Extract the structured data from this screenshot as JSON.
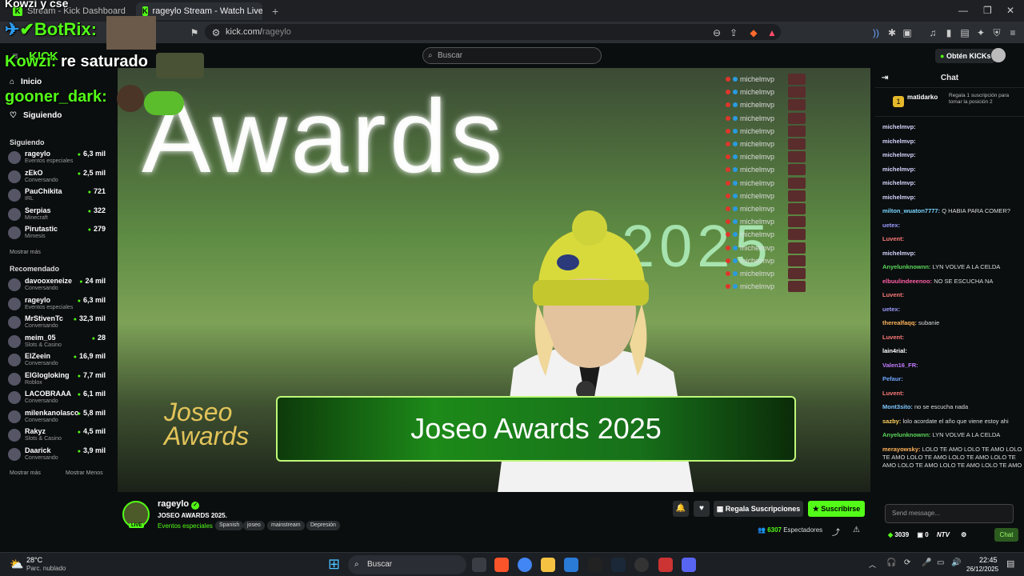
{
  "browser": {
    "tabs": [
      {
        "label": "Stream - Kick Dashboard"
      },
      {
        "label": "rageylo Stream - Watch Live o"
      }
    ],
    "new_tab_symbol": "+",
    "url_host": "kick.com/",
    "url_path": "rageylo"
  },
  "overlay": {
    "line1": "Kowzi y cse",
    "bot": "BotRix:",
    "kowzi_user": "Kowzi:",
    "kowzi_msg": "re saturado",
    "gooner": "gooner_dark:"
  },
  "kick": {
    "logo": "KICK",
    "search_placeholder": "Buscar",
    "kicks_button": "Obtén KICKs",
    "nav": [
      {
        "label": "Inicio"
      },
      {
        "label": "Siguiendo"
      }
    ],
    "following_title": "Siguiendo",
    "following": [
      {
        "name": "rageylo",
        "category": "Eventos especiales",
        "viewers": "6,3 mil"
      },
      {
        "name": "zEkO",
        "category": "Conversando",
        "viewers": "2,5 mil"
      },
      {
        "name": "PauChikita",
        "category": "IRL",
        "viewers": "721"
      },
      {
        "name": "Serpias",
        "category": "Minecraft",
        "viewers": "322"
      },
      {
        "name": "Pirutastic",
        "category": "Mimesis",
        "viewers": "279"
      }
    ],
    "show_more": "Mostrar más",
    "recommended_title": "Recomendado",
    "recommended": [
      {
        "name": "davooxeneize",
        "category": "Conversando",
        "viewers": "24 mil"
      },
      {
        "name": "rageylo",
        "category": "Eventos especiales",
        "viewers": "6,3 mil"
      },
      {
        "name": "MrStivenTc",
        "category": "Conversando",
        "viewers": "32,3 mil"
      },
      {
        "name": "meim_05",
        "category": "Slots & Casino",
        "viewers": "28"
      },
      {
        "name": "ElZeein",
        "category": "Conversando",
        "viewers": "16,9 mil"
      },
      {
        "name": "ElGlogloking",
        "category": "Roblox",
        "viewers": "7,7 mil"
      },
      {
        "name": "LACOBRAAA",
        "category": "Conversando",
        "viewers": "6,1 mil"
      },
      {
        "name": "milenkanolasco",
        "category": "Conversando",
        "viewers": "5,8 mil"
      },
      {
        "name": "Rakyz",
        "category": "Slots & Casino",
        "viewers": "4,5 mil"
      },
      {
        "name": "Daarick",
        "category": "Conversando",
        "viewers": "3,9 mil"
      }
    ],
    "show_more_2": "Mostrar más",
    "show_less": "Mostrar Menos"
  },
  "video": {
    "big_text": "Awards",
    "year": "2025",
    "logo_line1": "Joseo",
    "logo_line2": "Awards",
    "banner": "Joseo Awards 2025",
    "overlay_chat_user": "michelmvp"
  },
  "stream": {
    "name": "rageylo",
    "title": "JOSEO AWARDS 2025.",
    "category": "Eventos especiales",
    "tags": [
      "Spanish",
      "joseo",
      "mainstream",
      "Depresión"
    ],
    "live": "LIVE",
    "gift_button": "Regala Suscripciones",
    "subscribe_button": "Suscribirse",
    "viewers_count": "6307",
    "viewers_label": "Espectadores"
  },
  "chat": {
    "title": "Chat",
    "pinned_user": "matidarko",
    "pinned_rank": "1",
    "pinned_text": "Regala 1 suscripción para tomar la posición 2",
    "messages": [
      {
        "user": "michelmvp:",
        "text": "",
        "color": "#d6d6ff"
      },
      {
        "user": "michelmvp:",
        "text": "",
        "color": "#d6d6ff"
      },
      {
        "user": "michelmvp:",
        "text": "",
        "color": "#d6d6ff"
      },
      {
        "user": "michelmvp:",
        "text": "",
        "color": "#d6d6ff"
      },
      {
        "user": "michelmvp:",
        "text": "",
        "color": "#d6d6ff"
      },
      {
        "user": "michelmvp:",
        "text": "",
        "color": "#d6d6ff"
      },
      {
        "user": "milton_wuaton7777:",
        "text": "Q HABIA PARA COMER?",
        "color": "#78d6ff"
      },
      {
        "user": "uetex:",
        "text": "",
        "color": "#9b9bff"
      },
      {
        "user": "Luvent:",
        "text": "",
        "color": "#ff7a7a"
      },
      {
        "user": "michelmvp:",
        "text": "",
        "color": "#d6d6ff"
      },
      {
        "user": "Anyelunknownn:",
        "text": "LYN VOLVE A LA CELDA",
        "color": "#5bd65b"
      },
      {
        "user": "elbuulindeeenoo:",
        "text": "NO SE ESCUCHA NA",
        "color": "#ff5fa6"
      },
      {
        "user": "Luvent:",
        "text": "",
        "color": "#ff7a7a"
      },
      {
        "user": "uetex:",
        "text": "",
        "color": "#9b9bff"
      },
      {
        "user": "therealfaqq:",
        "text": "subanie",
        "color": "#ffb35b"
      },
      {
        "user": "Luvent:",
        "text": "",
        "color": "#ff7a7a"
      },
      {
        "user": "lain4rial:",
        "text": "",
        "color": "#ffffff"
      },
      {
        "user": "Valen16_FR:",
        "text": "",
        "color": "#c27bff"
      },
      {
        "user": "Pefaur:",
        "text": "",
        "color": "#6fa6ff"
      },
      {
        "user": "Luvent:",
        "text": "",
        "color": "#ff7a7a"
      },
      {
        "user": "Mont3sito:",
        "text": "no se escucha nada",
        "color": "#7fc8ff"
      },
      {
        "user": "sazby:",
        "text": "lolo acordate el año que viene estoy ahi",
        "color": "#ffd35b"
      },
      {
        "user": "Anyelunknownn:",
        "text": "LYN VOLVE A LA CELDA",
        "color": "#5bd65b"
      },
      {
        "user": "merayowsky:",
        "text": "LOLO TE AMO LOLO TE AMO LOLO TE AMO LOLO TE AMO LOLO TE AMO LOLO TE AMO LOLO TE AMO LOLO TE AMO LOLO TE AMO",
        "color": "#ffb35b"
      }
    ],
    "input_placeholder": "Send message...",
    "kicks_count": "3039",
    "points": "0",
    "ntv": "NTV",
    "send_button": "Chat"
  },
  "taskbar": {
    "temp": "28°C",
    "weather": "Parc. nublado",
    "search": "Buscar",
    "time": "22:45",
    "date": "26/12/2025"
  }
}
